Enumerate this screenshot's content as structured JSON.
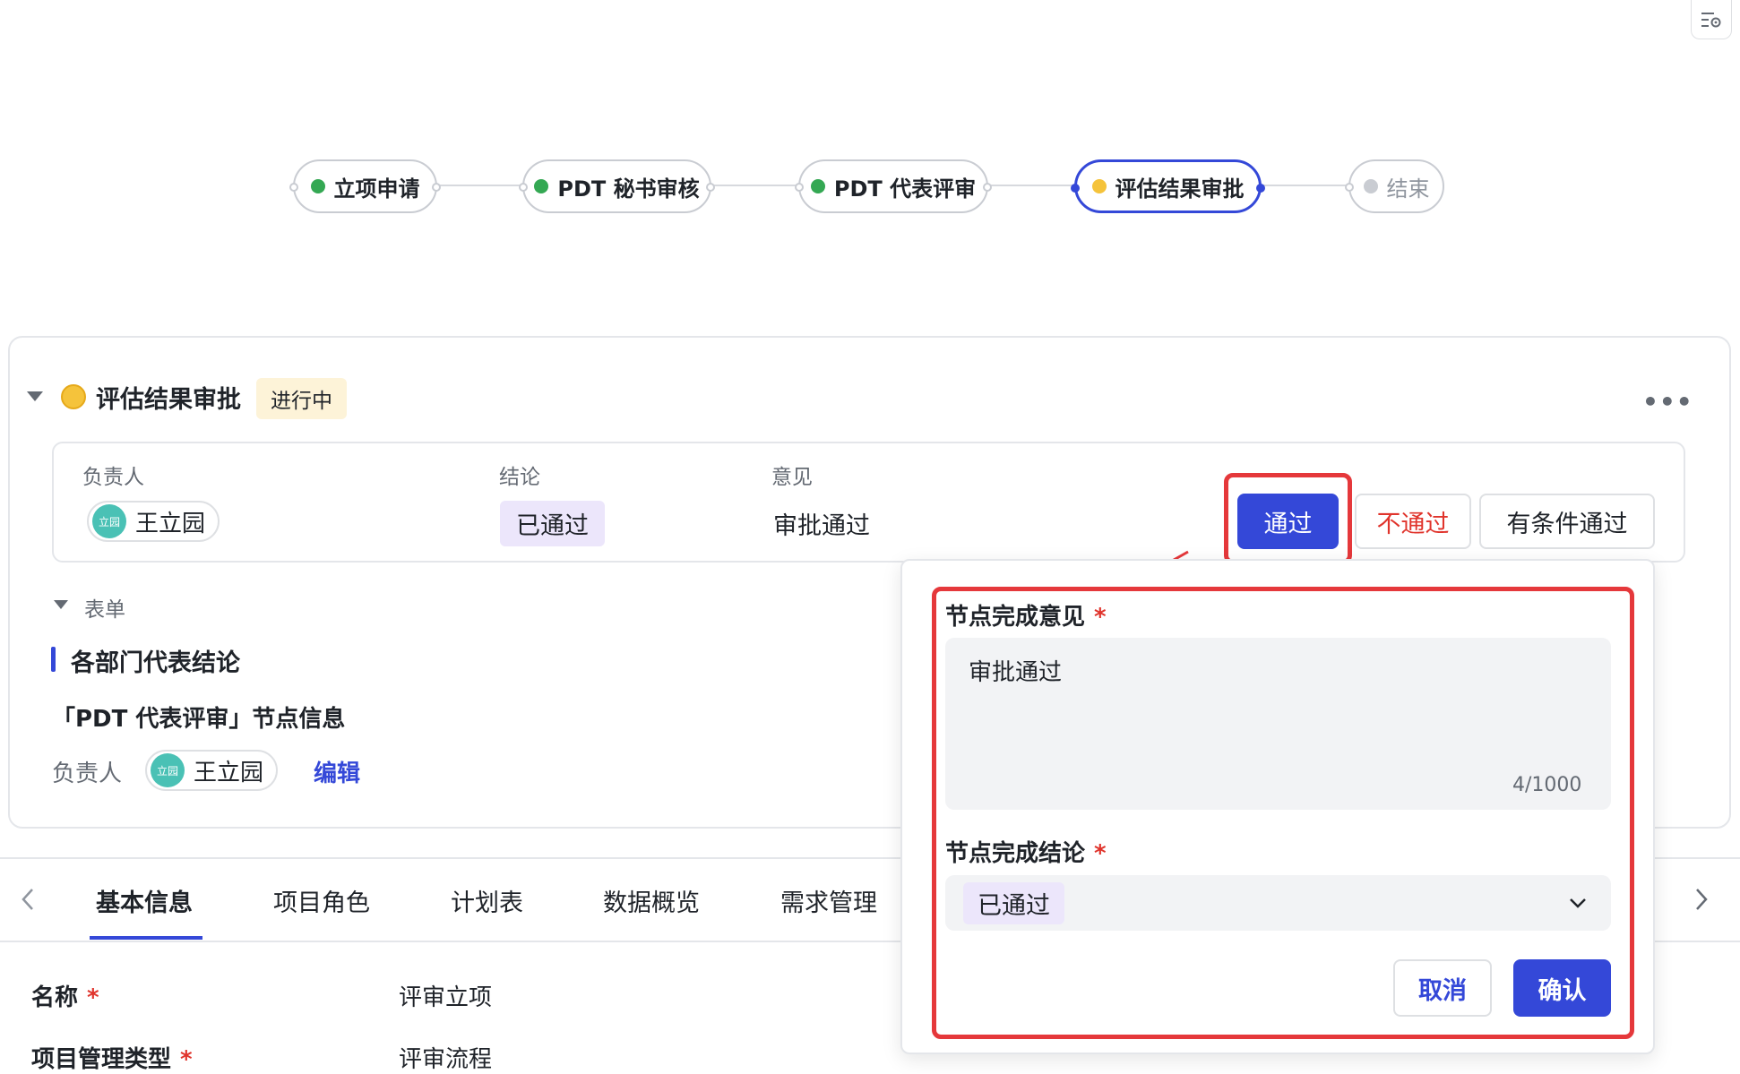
{
  "flow": {
    "nodes": [
      {
        "label": "立项申请",
        "status_color": "#34a853"
      },
      {
        "label": "PDT 秘书审核",
        "status_color": "#34a853"
      },
      {
        "label": "PDT 代表评审",
        "status_color": "#34a853"
      },
      {
        "label": "评估结果审批",
        "status_color": "#f5c33b"
      },
      {
        "label": "结束",
        "status_color": "#c9ccd2"
      }
    ]
  },
  "card": {
    "title": "评估结果审批",
    "status": "进行中",
    "owner_label": "负责人",
    "owner_name": "王立园",
    "owner_avatar": "立园",
    "conclusion_label": "结论",
    "conclusion_value": "已通过",
    "opinion_label": "意见",
    "opinion_value": "审批通过",
    "actions": {
      "pass": "通过",
      "reject": "不通过",
      "conditional": "有条件通过"
    },
    "form_toggle": "表单",
    "section_title": "各部门代表结论",
    "node_info_title": "「PDT 代表评审」节点信息",
    "node_owner_label": "负责人",
    "node_owner_name": "王立园",
    "node_owner_avatar": "立园",
    "edit_label": "编辑"
  },
  "popup": {
    "opinion_label": "节点完成意见",
    "required_mark": "*",
    "opinion_value": "审批通过",
    "counter": "4/1000",
    "conclusion_label": "节点完成结论",
    "conclusion_value": "已通过",
    "cancel": "取消",
    "confirm": "确认"
  },
  "tabs": [
    "基本信息",
    "项目角色",
    "计划表",
    "数据概览",
    "需求管理"
  ],
  "form": {
    "rows": [
      {
        "label": "名称",
        "value": "评审立项"
      },
      {
        "label": "项目管理类型",
        "value": "评审流程"
      }
    ]
  },
  "colors": {
    "accent": "#3448d8",
    "highlight": "#e5383b",
    "success": "#34a853",
    "pending": "#f5c33b"
  }
}
